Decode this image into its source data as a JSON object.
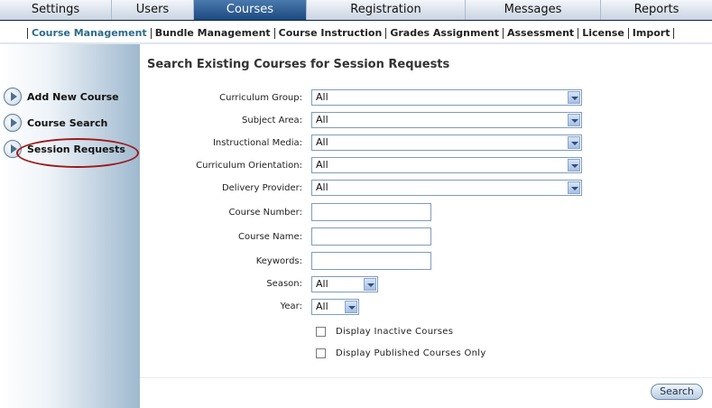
{
  "top_nav": {
    "tabs": [
      {
        "label": "Settings",
        "active": false
      },
      {
        "label": "Users",
        "active": false
      },
      {
        "label": "Courses",
        "active": true
      },
      {
        "label": "Registration",
        "active": false
      },
      {
        "label": "Messages",
        "active": false
      },
      {
        "label": "Reports",
        "active": false
      }
    ]
  },
  "sub_nav": {
    "items": [
      {
        "label": "Course Management",
        "active": true
      },
      {
        "label": "Bundle Management",
        "active": false
      },
      {
        "label": "Course Instruction",
        "active": false
      },
      {
        "label": "Grades Assignment",
        "active": false
      },
      {
        "label": "Assessment",
        "active": false
      },
      {
        "label": "License",
        "active": false
      },
      {
        "label": "Import",
        "active": false
      }
    ]
  },
  "sidebar": {
    "items": [
      {
        "label": "Add New Course",
        "icon": "arrow-circle-icon"
      },
      {
        "label": "Course Search",
        "icon": "arrow-circle-icon"
      },
      {
        "label": "Session Requests",
        "icon": "arrow-circle-icon",
        "highlighted": true
      }
    ]
  },
  "main": {
    "title": "Search Existing Courses for Session Requests",
    "fields": {
      "curriculum_group": {
        "label": "Curriculum Group:",
        "value": "All"
      },
      "subject_area": {
        "label": "Subject Area:",
        "value": "All"
      },
      "instructional_media": {
        "label": "Instructional Media:",
        "value": "All"
      },
      "curriculum_orientation": {
        "label": "Curriculum Orientation:",
        "value": "All"
      },
      "delivery_provider": {
        "label": "Delivery Provider:",
        "value": "All"
      },
      "course_number": {
        "label": "Course Number:",
        "value": ""
      },
      "course_name": {
        "label": "Course Name:",
        "value": ""
      },
      "keywords": {
        "label": "Keywords:",
        "value": ""
      },
      "season": {
        "label": "Season:",
        "value": "All"
      },
      "year": {
        "label": "Year:",
        "value": "All"
      }
    },
    "checkboxes": {
      "inactive": {
        "label": "Display Inactive Courses",
        "checked": false
      },
      "published": {
        "label": "Display Published Courses Only",
        "checked": false
      }
    },
    "search_label": "Search"
  }
}
